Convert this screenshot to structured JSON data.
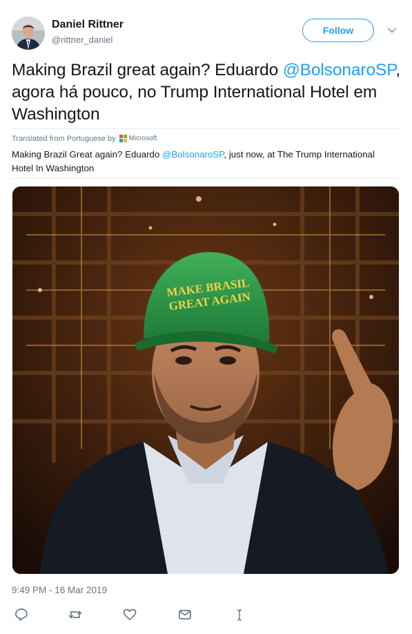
{
  "user": {
    "name": "Daniel Rittner",
    "handle": "@rittner_daniel"
  },
  "follow_label": "Follow",
  "tweet": {
    "text_part1": "Making Brazil great again? Eduardo ",
    "mention": "@BolsonaroSP",
    "text_part2": ", agora há pouco, no Trump International Hotel em Washington"
  },
  "translation": {
    "notice": "Translated from Portuguese by",
    "provider": "Microsoft",
    "text_part1": "Making Brazil Great again? Eduardo ",
    "mention": "@BolsonaroSP",
    "text_part2": ", just now, at The Trump International Hotel In Washington"
  },
  "photo": {
    "cap_text_line1": "MAKE BRASIL",
    "cap_text_line2": "GREAT AGAIN"
  },
  "timestamp": "9:49 PM - 16 Mar 2019",
  "actions": {
    "reply": "reply-icon",
    "retweet": "retweet-icon",
    "like": "heart-icon",
    "message": "envelope-icon"
  },
  "colors": {
    "accent": "#1da1f2",
    "secondary_text": "#657786",
    "divider": "#e6ecf0"
  }
}
